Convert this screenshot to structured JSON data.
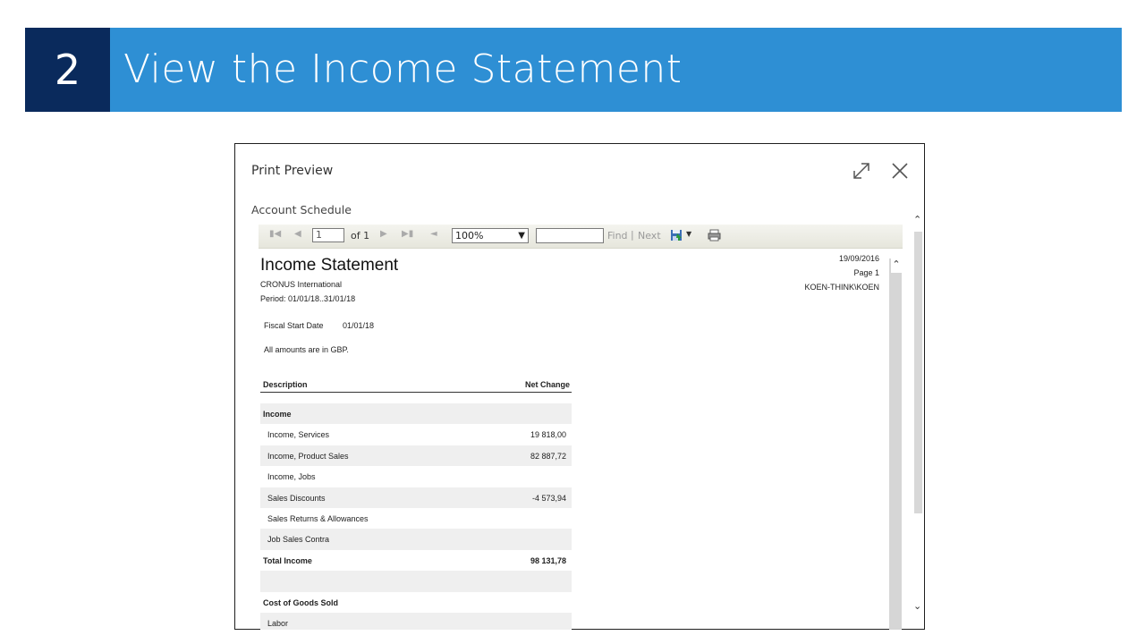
{
  "slide": {
    "number": "2",
    "title": "View the Income Statement"
  },
  "dialog": {
    "title": "Print Preview",
    "subtitle": "Account Schedule"
  },
  "toolbar": {
    "page_value": "1",
    "of_text": "of 1",
    "zoom": "100%",
    "find_label": "Find",
    "separator": "|",
    "next_label": "Next"
  },
  "report": {
    "title": "Income Statement",
    "company": "CRONUS International",
    "period": "Period: 01/01/18..31/01/18",
    "fiscal_start_label": "Fiscal Start Date",
    "fiscal_start_value": "01/01/18",
    "amounts_note": "All amounts are in GBP.",
    "date": "19/09/2016",
    "page": "Page 1",
    "user": "KOEN-THINK\\KOEN",
    "col_description": "Description",
    "col_net_change": "Net Change",
    "rows": [
      {
        "description": "Income",
        "value": "",
        "bold": true,
        "shade": true
      },
      {
        "description": "Income, Services",
        "value": "19 818,00",
        "bold": false,
        "shade": false
      },
      {
        "description": "Income, Product Sales",
        "value": "82 887,72",
        "bold": false,
        "shade": true
      },
      {
        "description": "Income, Jobs",
        "value": "",
        "bold": false,
        "shade": false
      },
      {
        "description": "Sales Discounts",
        "value": "-4 573,94",
        "bold": false,
        "shade": true
      },
      {
        "description": "Sales Returns & Allowances",
        "value": "",
        "bold": false,
        "shade": false
      },
      {
        "description": "Job Sales Contra",
        "value": "",
        "bold": false,
        "shade": true
      },
      {
        "description": "Total Income",
        "value": "98 131,78",
        "bold": true,
        "shade": false
      },
      {
        "description": "",
        "value": "",
        "bold": false,
        "shade": true
      },
      {
        "description": "Cost of Goods Sold",
        "value": "",
        "bold": true,
        "shade": false
      },
      {
        "description": "Labor",
        "value": "",
        "bold": false,
        "shade": true
      }
    ]
  },
  "colors": {
    "slide_header": "#2e8fd4",
    "slide_number_bg": "#0a2a5c"
  }
}
